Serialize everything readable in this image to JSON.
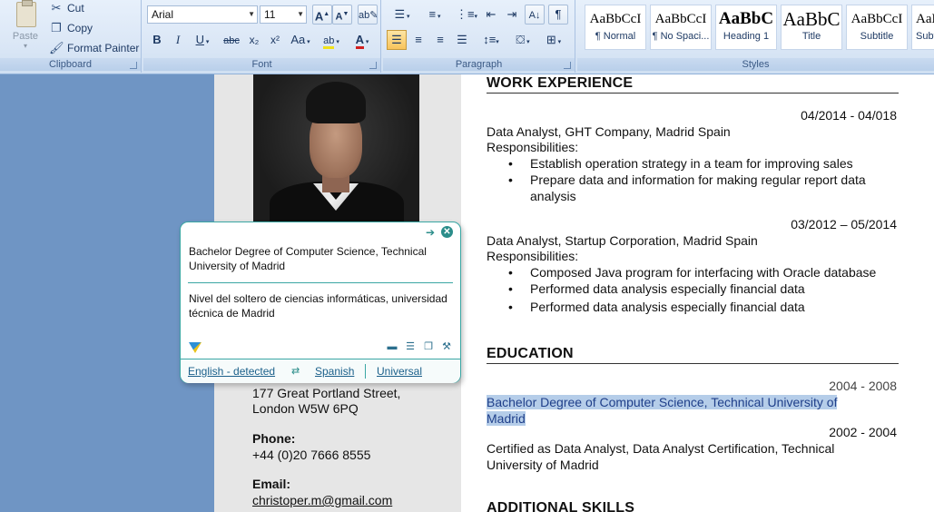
{
  "ribbon": {
    "clipboard": {
      "label": "Clipboard",
      "paste": "Paste",
      "cut": "Cut",
      "copy": "Copy",
      "format_painter": "Format Painter"
    },
    "font": {
      "label": "Font",
      "font_name": "Arial",
      "font_size": "11",
      "grow": "A",
      "shrink": "A",
      "bold": "B",
      "italic": "I",
      "underline": "U",
      "strike": "abc",
      "subscript": "x₂",
      "superscript": "x²",
      "change_case": "Aa",
      "highlight": "ab",
      "font_color": "A"
    },
    "paragraph": {
      "label": "Paragraph"
    },
    "styles": {
      "label": "Styles",
      "items": [
        {
          "sample": "AaBbCcI",
          "name": "¶ Normal"
        },
        {
          "sample": "AaBbCcI",
          "name": "¶ No Spaci..."
        },
        {
          "sample": "AaBbC",
          "name": "Heading 1"
        },
        {
          "sample": "AaBbC",
          "name": "Title"
        },
        {
          "sample": "AaBbCcI",
          "name": "Subtitle"
        },
        {
          "sample": "AaBbCcI",
          "name": "Subtl"
        }
      ]
    }
  },
  "left_column": {
    "address_line1": "177 Great Portland Street,",
    "address_line2": "London W5W 6PQ",
    "phone_label": "Phone:",
    "phone": "+44 (0)20 7666 8555",
    "email_label": "Email:",
    "email": "christoper.m@gmail.com"
  },
  "work": {
    "title": "WORK EXPERIENCE",
    "jobs": [
      {
        "dates": "04/2014 - 04/018",
        "position": "Data Analyst, GHT Company, Madrid Spain",
        "resp_label": "Responsibilities:",
        "bullets": [
          "Establish operation strategy in a team for improving sales",
          "Prepare data and information for making regular report data analysis"
        ]
      },
      {
        "dates": "03/2012 – 05/2014",
        "position": "Data Analyst, Startup Corporation, Madrid Spain",
        "resp_label": "Responsibilities:",
        "bullets": [
          "Composed Java program for interfacing with Oracle database",
          "Performed data analysis especially financial data",
          "Performed data analysis especially financial data"
        ]
      }
    ]
  },
  "education": {
    "title": "EDUCATION",
    "entries": [
      {
        "dates": "2004 - 2008",
        "text": "Bachelor Degree of Computer Science, Technical University of Madrid"
      },
      {
        "dates": "2002 - 2004",
        "text": "Certified as Data Analyst, Data Analyst Certification, Technical University of Madrid"
      }
    ]
  },
  "additional": {
    "title": "ADDITIONAL SKILLS"
  },
  "popup": {
    "source_text": "Bachelor Degree of Computer Science, Technical University of Madrid",
    "translated_text": "Nivel del soltero de ciencias informáticas, universidad técnica de Madrid",
    "from_lang": "English - detected",
    "to_lang": "Spanish",
    "mode": "Universal"
  },
  "colors": {
    "background": "#6f95c4",
    "ribbon": "#dbe7f6",
    "popup_border": "#3aa7a4",
    "selection_highlight": "#b5cde9"
  }
}
